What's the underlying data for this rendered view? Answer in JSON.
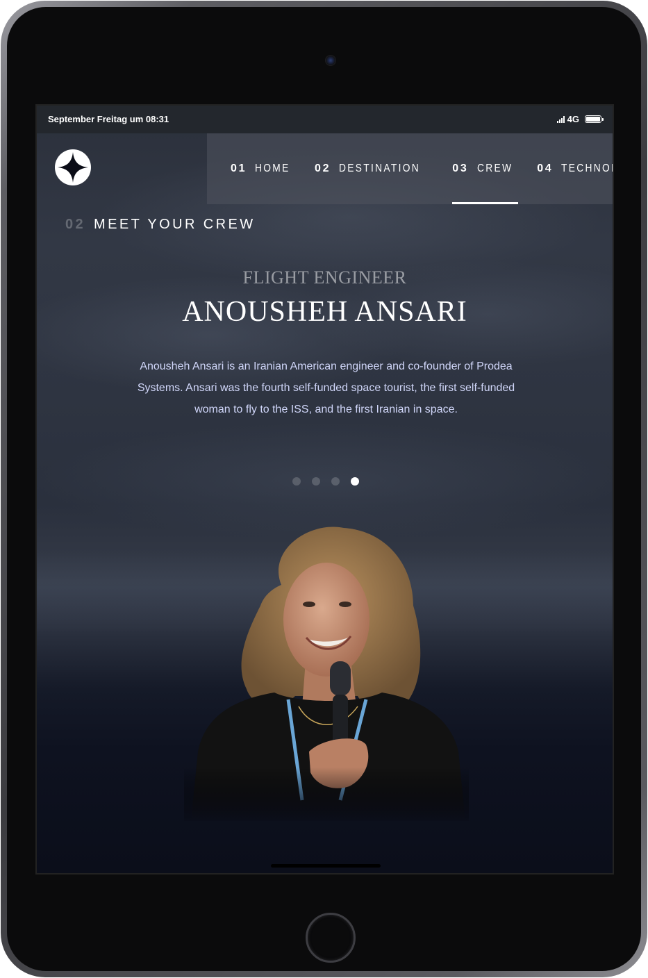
{
  "status_bar": {
    "time": "September Freitag um 08:31",
    "network": "4G"
  },
  "nav": {
    "items": [
      {
        "number": "01",
        "label": "HOME",
        "active": false
      },
      {
        "number": "02",
        "label": "DESTINATION",
        "active": false
      },
      {
        "number": "03",
        "label": "CREW",
        "active": true
      },
      {
        "number": "04",
        "label": "TECHNOLOGY",
        "active": false
      }
    ]
  },
  "page": {
    "section_number": "02",
    "section_title": "MEET YOUR CREW"
  },
  "crew": {
    "role": "FLIGHT ENGINEER",
    "name": "ANOUSHEH ANSARI",
    "bio": "Anousheh Ansari is an Iranian American engineer and co-founder of Prodea Systems. Ansari was the fourth self-funded space tourist, the first self-funded woman to fly to the ISS, and the first Iranian in space.",
    "slides_total": 4,
    "active_slide": 4
  },
  "colors": {
    "background": "#0b0d17",
    "accent_text": "#d0d6f9",
    "white": "#ffffff"
  },
  "icons": {
    "logo": "star-logo-icon",
    "signal": "cellular-signal-icon",
    "battery": "battery-icon"
  }
}
